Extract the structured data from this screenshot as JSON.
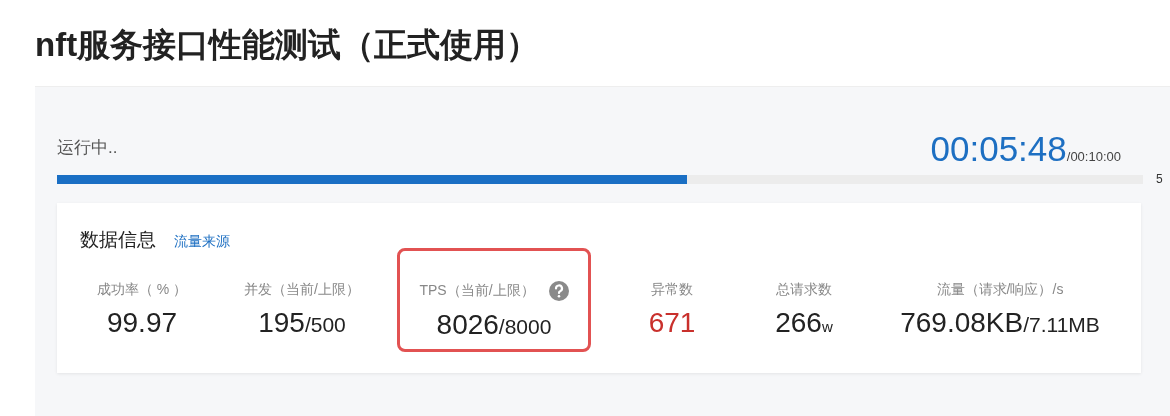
{
  "title": "nft服务接口性能测试（正式使用）",
  "run": {
    "status": "运行中..",
    "elapsed": "00:05:48",
    "total": "/00:10:00",
    "level": 0.58,
    "percent": "5"
  },
  "data_info": {
    "heading": "数据信息",
    "link": "流量来源",
    "metrics": [
      {
        "label": "成功率（ % ）",
        "value": "99.97",
        "alert": false,
        "highlighted": false,
        "help": false
      },
      {
        "label": "并发（当前/上限）",
        "value": "195",
        "suffix": "/500",
        "alert": false,
        "highlighted": false,
        "help": false
      },
      {
        "label": "TPS（当前/上限）",
        "value": "8026",
        "suffix": "/8000",
        "alert": false,
        "highlighted": true,
        "help": true
      },
      {
        "label": "异常数",
        "value": "671",
        "alert": true,
        "highlighted": false,
        "help": false
      },
      {
        "label": "总请求数",
        "value": "266",
        "suffix": "w",
        "alert": false,
        "highlighted": false,
        "help": false
      },
      {
        "label": "流量（请求/响应）/s",
        "value": "769.08KB",
        "suffix": "/7.11MB",
        "alert": false,
        "highlighted": false,
        "help": false
      }
    ]
  }
}
